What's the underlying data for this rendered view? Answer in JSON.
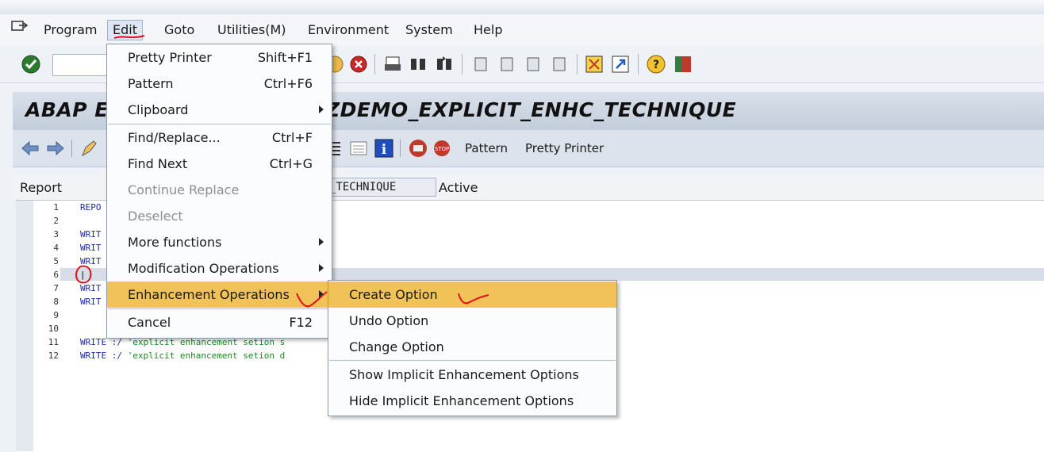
{
  "menubar": {
    "items": [
      {
        "label": "Program"
      },
      {
        "label": "Edit"
      },
      {
        "label": "Goto"
      },
      {
        "label": "Utilities(M)"
      },
      {
        "label": "Environment"
      },
      {
        "label": "System"
      },
      {
        "label": "Help"
      }
    ]
  },
  "title": {
    "left": "ABAP Ed",
    "right": "ZDEMO_EXPLICIT_ENHC_TECHNIQUE"
  },
  "app_toolbar": {
    "pattern_label": "Pattern",
    "pretty_printer_label": "Pretty Printer"
  },
  "report": {
    "label": "Report",
    "field_value": "_TECHNIQUE",
    "status": "Active"
  },
  "editor": {
    "lines": [
      {
        "no": "1",
        "code": "REPO"
      },
      {
        "no": "2",
        "code": ""
      },
      {
        "no": "3",
        "code": "WRIT"
      },
      {
        "no": "4",
        "code": "WRIT"
      },
      {
        "no": "5",
        "code": "WRIT"
      },
      {
        "no": "6",
        "code": "|"
      },
      {
        "no": "7",
        "code": "WRIT"
      },
      {
        "no": "8",
        "code": "WRIT"
      },
      {
        "no": "9",
        "code": ""
      },
      {
        "no": "10",
        "code": ""
      },
      {
        "no": "11",
        "code_kw": "WRITE :/ ",
        "code_str": "'explicit enhancement setion s"
      },
      {
        "no": "12",
        "code_kw": "WRITE :/ ",
        "code_str": "'explicit enhancement setion d"
      }
    ]
  },
  "edit_menu": {
    "items": [
      {
        "label": "Pretty Printer",
        "shortcut": "Shift+F1"
      },
      {
        "label": "Pattern",
        "shortcut": "Ctrl+F6"
      },
      {
        "label": "Clipboard",
        "shortcut": ""
      },
      {
        "label": "Find/Replace...",
        "shortcut": "Ctrl+F"
      },
      {
        "label": "Find Next",
        "shortcut": "Ctrl+G"
      },
      {
        "label": "Continue Replace",
        "shortcut": ""
      },
      {
        "label": "Deselect",
        "shortcut": ""
      },
      {
        "label": "More functions",
        "shortcut": ""
      },
      {
        "label": "Modification Operations",
        "shortcut": ""
      },
      {
        "label": "Enhancement Operations",
        "shortcut": ""
      },
      {
        "label": "Cancel",
        "shortcut": "F12"
      }
    ]
  },
  "enhancement_submenu": {
    "items": [
      {
        "label": "Create Option"
      },
      {
        "label": "Undo Option"
      },
      {
        "label": "Change Option"
      },
      {
        "label": "Show Implicit Enhancement Options"
      },
      {
        "label": "Hide Implicit Enhancement Options"
      }
    ]
  },
  "colors": {
    "highlight": "#f0c258",
    "annotation": "#e0101a",
    "keyword": "#1c2ba8",
    "string": "#1b8a23"
  },
  "icons": [
    "app-menu-icon",
    "enter-check-icon",
    "exit-icon",
    "cancel-icon",
    "print-icon",
    "find-icon",
    "find-next-icon",
    "first-page-icon",
    "prev-page-icon",
    "next-page-icon",
    "last-page-icon",
    "create-session-icon",
    "shortcut-icon",
    "help-icon",
    "layout-icon",
    "back-arrow-icon",
    "forward-arrow-icon",
    "display-change-icon",
    "info-icon"
  ]
}
